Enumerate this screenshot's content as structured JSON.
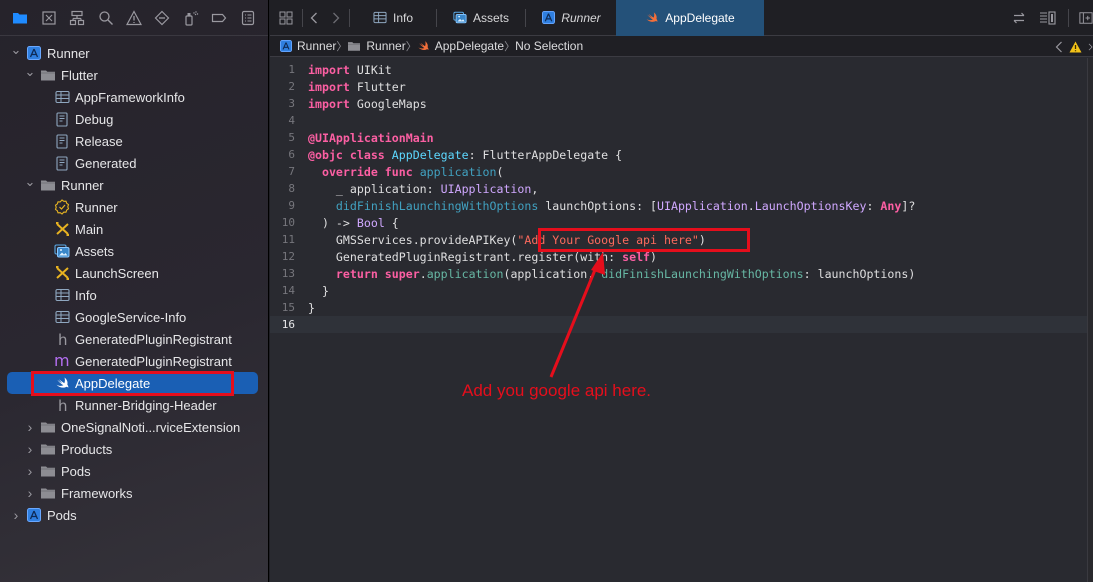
{
  "navigator_toolbar": {
    "icons": [
      {
        "name": "project-navigator-icon",
        "active": true
      },
      {
        "name": "source-control-navigator-icon"
      },
      {
        "name": "symbol-navigator-icon"
      },
      {
        "name": "find-navigator-icon"
      },
      {
        "name": "issue-navigator-icon"
      },
      {
        "name": "test-navigator-icon"
      },
      {
        "name": "debug-navigator-icon"
      },
      {
        "name": "breakpoint-navigator-icon"
      },
      {
        "name": "report-navigator-icon"
      }
    ]
  },
  "project_tree": [
    {
      "label": "Runner",
      "depth": 0,
      "icon": "xcode-project-icon",
      "expanded": true
    },
    {
      "label": "Flutter",
      "depth": 1,
      "icon": "folder-icon",
      "expanded": true
    },
    {
      "label": "AppFrameworkInfo",
      "depth": 2,
      "icon": "plist-icon"
    },
    {
      "label": "Debug",
      "depth": 2,
      "icon": "xcconfig-icon"
    },
    {
      "label": "Release",
      "depth": 2,
      "icon": "xcconfig-icon"
    },
    {
      "label": "Generated",
      "depth": 2,
      "icon": "xcconfig-icon"
    },
    {
      "label": "Runner",
      "depth": 1,
      "icon": "folder-icon",
      "expanded": true
    },
    {
      "label": "Runner",
      "depth": 2,
      "icon": "entitlements-icon"
    },
    {
      "label": "Main",
      "depth": 2,
      "icon": "storyboard-icon"
    },
    {
      "label": "Assets",
      "depth": 2,
      "icon": "asset-catalog-icon"
    },
    {
      "label": "LaunchScreen",
      "depth": 2,
      "icon": "storyboard-icon"
    },
    {
      "label": "Info",
      "depth": 2,
      "icon": "plist-icon"
    },
    {
      "label": "GoogleService-Info",
      "depth": 2,
      "icon": "plist-icon"
    },
    {
      "label": "GeneratedPluginRegistrant",
      "depth": 2,
      "icon": "header-file-icon"
    },
    {
      "label": "GeneratedPluginRegistrant",
      "depth": 2,
      "icon": "objc-file-icon"
    },
    {
      "label": "AppDelegate",
      "depth": 2,
      "icon": "swift-file-icon",
      "selected": true
    },
    {
      "label": "Runner-Bridging-Header",
      "depth": 2,
      "icon": "header-file-icon"
    },
    {
      "label": "OneSignalNoti...rviceExtension",
      "depth": 1,
      "icon": "folder-icon",
      "expanded": false
    },
    {
      "label": "Products",
      "depth": 1,
      "icon": "folder-icon",
      "expanded": false
    },
    {
      "label": "Pods",
      "depth": 1,
      "icon": "folder-icon",
      "expanded": false
    },
    {
      "label": "Frameworks",
      "depth": 1,
      "icon": "folder-icon",
      "expanded": false
    },
    {
      "label": "Pods",
      "depth": 0,
      "icon": "xcode-project-icon",
      "expanded": false
    }
  ],
  "tabs": [
    {
      "label": "Info",
      "icon": "plist-icon"
    },
    {
      "label": "Assets",
      "icon": "asset-catalog-icon"
    },
    {
      "label": "Runner",
      "icon": "xcode-project-icon",
      "italic": true
    },
    {
      "label": "AppDelegate",
      "icon": "swift-file-icon",
      "active": true
    }
  ],
  "jump_bar": {
    "items": [
      {
        "label": "Runner",
        "icon": "xcode-project-icon"
      },
      {
        "label": "Runner",
        "icon": "folder-icon"
      },
      {
        "label": "AppDelegate",
        "icon": "swift-file-icon"
      },
      {
        "label": "No Selection",
        "icon": ""
      }
    ]
  },
  "code": {
    "current_line": 16,
    "lines": [
      [
        [
          "kw",
          "import"
        ],
        [
          "plain",
          " UIKit"
        ]
      ],
      [
        [
          "kw",
          "import"
        ],
        [
          "plain",
          " Flutter"
        ]
      ],
      [
        [
          "kw",
          "import"
        ],
        [
          "plain",
          " GoogleMaps"
        ]
      ],
      [],
      [
        [
          "attr",
          "@UIApplicationMain"
        ]
      ],
      [
        [
          "attr",
          "@objc"
        ],
        [
          "plain",
          " "
        ],
        [
          "kw",
          "class"
        ],
        [
          "plain",
          " "
        ],
        [
          "tdecl",
          "AppDelegate"
        ],
        [
          "plain",
          ": FlutterAppDelegate {"
        ]
      ],
      [
        [
          "plain",
          "  "
        ],
        [
          "kw",
          "override"
        ],
        [
          "plain",
          " "
        ],
        [
          "kw",
          "func"
        ],
        [
          "plain",
          " "
        ],
        [
          "fdecl",
          "application"
        ],
        [
          "plain",
          "("
        ]
      ],
      [
        [
          "plain",
          "    _ application: "
        ],
        [
          "type",
          "UIApplication"
        ],
        [
          "plain",
          ","
        ]
      ],
      [
        [
          "plain",
          "    "
        ],
        [
          "fdecl",
          "didFinishLaunchingWithOptions"
        ],
        [
          "plain",
          " launchOptions: ["
        ],
        [
          "type",
          "UIApplication"
        ],
        [
          "plain",
          "."
        ],
        [
          "type",
          "LaunchOptionsKey"
        ],
        [
          "plain",
          ": "
        ],
        [
          "kw",
          "Any"
        ],
        [
          "plain",
          "]?"
        ]
      ],
      [
        [
          "plain",
          "  ) -> "
        ],
        [
          "type",
          "Bool"
        ],
        [
          "plain",
          " {"
        ]
      ],
      [
        [
          "plain",
          "    GMSServices.provideAPIKey("
        ],
        [
          "str",
          "\"Add Your Google api here\""
        ],
        [
          "plain",
          ")"
        ]
      ],
      [
        [
          "plain",
          "    GeneratedPluginRegistrant.register(with: "
        ],
        [
          "kw",
          "self"
        ],
        [
          "plain",
          ")"
        ]
      ],
      [
        [
          "plain",
          "    "
        ],
        [
          "kw",
          "return"
        ],
        [
          "plain",
          " "
        ],
        [
          "kw",
          "super"
        ],
        [
          "plain",
          "."
        ],
        [
          "proj",
          "application"
        ],
        [
          "plain",
          "(application, "
        ],
        [
          "proj",
          "didFinishLaunchingWithOptions"
        ],
        [
          "plain",
          ": launchOptions)"
        ]
      ],
      [
        [
          "plain",
          "  }"
        ]
      ],
      [
        [
          "plain",
          "}"
        ]
      ],
      []
    ]
  },
  "annotation": {
    "text": "Add you google api here.",
    "color": "#e50e1c"
  },
  "colors": {
    "selection": "#1a5fb4",
    "active_tab": "#245179",
    "keyword": "#fc5fa3",
    "string": "#fc6a5d",
    "type": "#d0a8ff",
    "decl_type": "#5dd8ff",
    "decl_func": "#41a1c0",
    "project_symbol": "#67b7a4"
  }
}
